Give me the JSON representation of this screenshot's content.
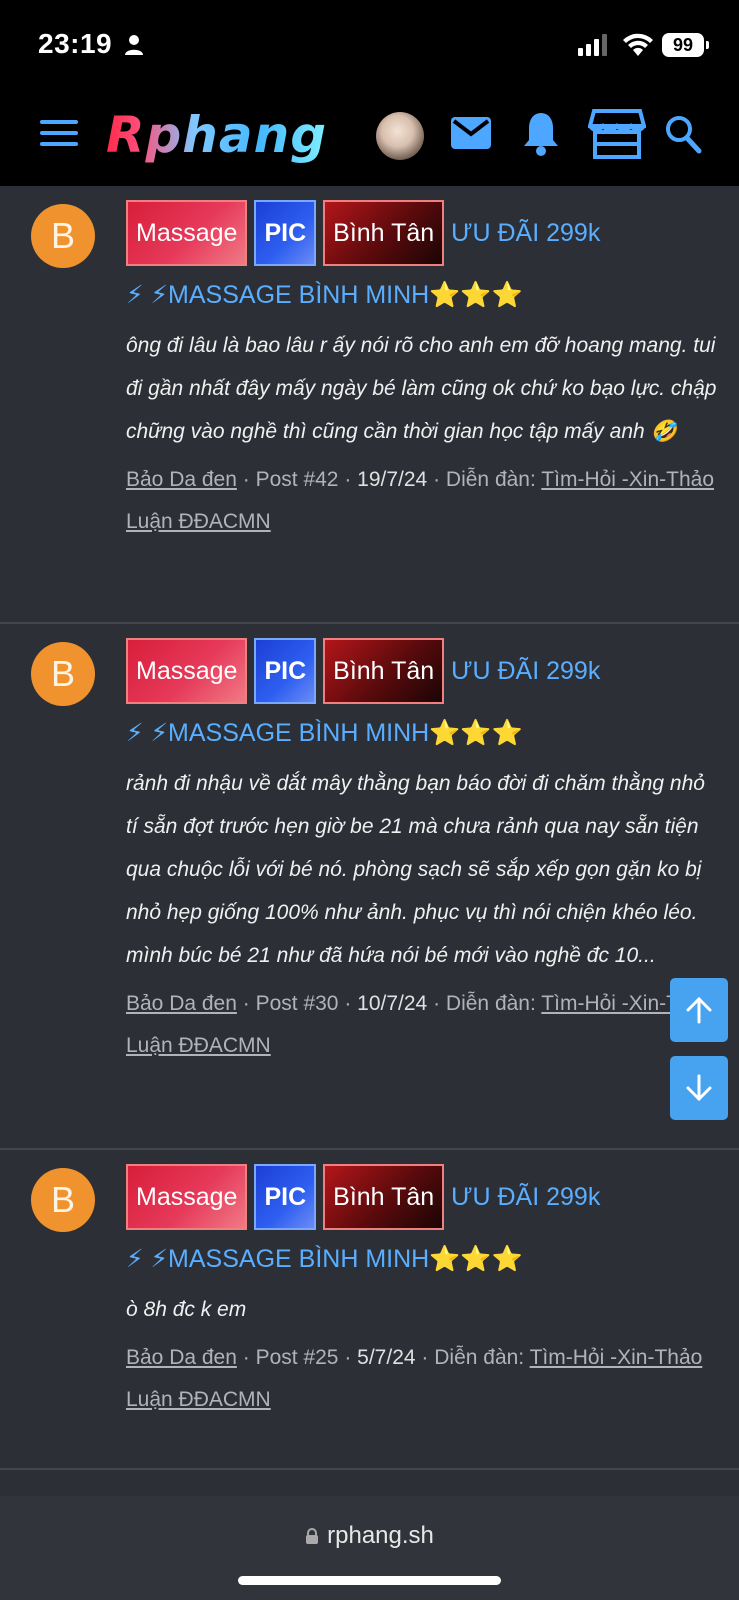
{
  "status_bar": {
    "time": "23:19",
    "battery": "99"
  },
  "header": {
    "logo": "Rphang"
  },
  "posts": [
    {
      "avatar_letter": "B",
      "tag_massage": "Massage",
      "tag_pic": "PIC",
      "tag_area": "Bình Tân",
      "title_rest": "ƯU ĐÃI 299k",
      "subtitle": "⚡ ⚡MASSAGE BÌNH MINH⭐⭐⭐",
      "excerpt": "ông đi lâu là bao lâu r ấy nói rõ cho anh em đỡ hoang mang. tui đi gần nhất đây mấy ngày bé làm cũng ok chứ ko bạo lực. chập chững vào nghề thì cũng cần thời gian học tập mấy anh 🤣",
      "author": "Bảo Da đen",
      "post_no": "Post #42",
      "date": "19/7/24",
      "forum_label": "Diễn đàn:",
      "forum": "Tìm-Hỏi -Xin-Thảo Luận ĐĐACMN"
    },
    {
      "avatar_letter": "B",
      "tag_massage": "Massage",
      "tag_pic": "PIC",
      "tag_area": "Bình Tân",
      "title_rest": "ƯU ĐÃI 299k",
      "subtitle": "⚡ ⚡MASSAGE BÌNH MINH⭐⭐⭐",
      "excerpt": "rảnh đi nhậu về dắt mây thằng bạn báo đời đi chăm thằng nhỏ tí sẵn đợt trước hẹn giờ be 21 mà chưa rảnh qua nay sẵn tiện qua chuộc lỗi với bé nó. phòng sạch sẽ sắp xếp gọn gặn ko bị nhỏ hẹp giống 100% như ảnh. phục vụ thì nói chiện khéo léo. mình búc bé 21 như đã hứa nói bé mới vào nghề đc 10...",
      "author": "Bảo Da đen",
      "post_no": "Post #30",
      "date": "10/7/24",
      "forum_label": "Diễn đàn:",
      "forum": "Tìm-Hỏi -Xin-Thảo Luận ĐĐACMN"
    },
    {
      "avatar_letter": "B",
      "tag_massage": "Massage",
      "tag_pic": "PIC",
      "tag_area": "Bình Tân",
      "title_rest": "ƯU ĐÃI 299k",
      "subtitle": "⚡ ⚡MASSAGE BÌNH MINH⭐⭐⭐",
      "excerpt": "ò 8h đc k em",
      "author": "Bảo Da đen",
      "post_no": "Post #25",
      "date": "5/7/24",
      "forum_label": "Diễn đàn:",
      "forum": "Tìm-Hỏi -Xin-Thảo Luận ĐĐACMN"
    }
  ],
  "browser": {
    "url": "rphang.sh"
  },
  "colors": {
    "accent": "#5aaeff",
    "avatar": "#f0922e",
    "background": "#2c2f36",
    "fab": "#47a3ef"
  }
}
